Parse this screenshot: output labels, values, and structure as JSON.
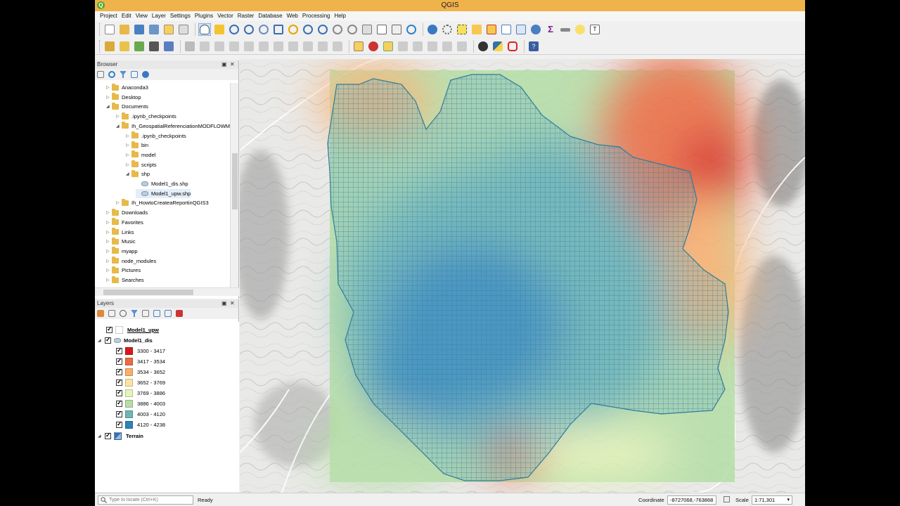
{
  "window": {
    "title": "QGIS",
    "logo_letter": "Q"
  },
  "menubar": [
    "Project",
    "Edit",
    "View",
    "Layer",
    "Settings",
    "Plugins",
    "Vector",
    "Raster",
    "Database",
    "Web",
    "Processing",
    "Help"
  ],
  "browser": {
    "title": "Browser",
    "items": [
      {
        "label": "Anaconda3",
        "type": "folder",
        "depth": 1,
        "state": "collapsed"
      },
      {
        "label": "Desktop",
        "type": "folder",
        "depth": 1,
        "state": "collapsed"
      },
      {
        "label": "Documents",
        "type": "folder",
        "depth": 1,
        "state": "expanded"
      },
      {
        "label": ".ipynb_checkpoints",
        "type": "folder",
        "depth": 2,
        "state": "collapsed"
      },
      {
        "label": "Ih_GeospatialReferenciationMODFLOWM",
        "type": "folder",
        "depth": 2,
        "state": "expanded"
      },
      {
        "label": ".ipynb_checkpoints",
        "type": "folder",
        "depth": 3,
        "state": "collapsed"
      },
      {
        "label": "bin",
        "type": "folder",
        "depth": 3,
        "state": "collapsed"
      },
      {
        "label": "model",
        "type": "folder",
        "depth": 3,
        "state": "collapsed"
      },
      {
        "label": "scripts",
        "type": "folder",
        "depth": 3,
        "state": "collapsed"
      },
      {
        "label": "shp",
        "type": "folder",
        "depth": 3,
        "state": "expanded"
      },
      {
        "label": "Model1_dis.shp",
        "type": "shp",
        "depth": 4,
        "state": "none"
      },
      {
        "label": "Model1_upw.shp",
        "type": "shp",
        "depth": 4,
        "state": "selected"
      },
      {
        "label": "Ih_HowtoCreateaReportinQGIS3",
        "type": "folder",
        "depth": 2,
        "state": "collapsed"
      },
      {
        "label": "Downloads",
        "type": "folder",
        "depth": 1,
        "state": "collapsed"
      },
      {
        "label": "Favorites",
        "type": "folder",
        "depth": 1,
        "state": "collapsed"
      },
      {
        "label": "Links",
        "type": "folder",
        "depth": 1,
        "state": "collapsed"
      },
      {
        "label": "Music",
        "type": "folder",
        "depth": 1,
        "state": "collapsed"
      },
      {
        "label": "myapp",
        "type": "folder",
        "depth": 1,
        "state": "collapsed"
      },
      {
        "label": "node_modules",
        "type": "folder",
        "depth": 1,
        "state": "collapsed"
      },
      {
        "label": "Pictures",
        "type": "folder",
        "depth": 1,
        "state": "collapsed"
      },
      {
        "label": "Searches",
        "type": "folder",
        "depth": 1,
        "state": "collapsed"
      }
    ]
  },
  "layers": {
    "title": "Layers",
    "items": [
      {
        "label": "Model1_upw",
        "kind": "layer",
        "checked": true,
        "bold": true,
        "underline": true
      },
      {
        "label": "Model1_dis",
        "kind": "layer-group",
        "checked": true,
        "bold": true
      },
      {
        "label": "3300 - 3417",
        "kind": "class",
        "checked": true,
        "color": "#d7191c"
      },
      {
        "label": "3417 - 3534",
        "kind": "class",
        "checked": true,
        "color": "#eb6a41"
      },
      {
        "label": "3534 - 3652",
        "kind": "class",
        "checked": true,
        "color": "#f9ae6a"
      },
      {
        "label": "3652 - 3769",
        "kind": "class",
        "checked": true,
        "color": "#fde3a2"
      },
      {
        "label": "3769 - 3886",
        "kind": "class",
        "checked": true,
        "color": "#e6f4b8"
      },
      {
        "label": "3886 - 4003",
        "kind": "class",
        "checked": true,
        "color": "#b5dea6"
      },
      {
        "label": "4003 - 4120",
        "kind": "class",
        "checked": true,
        "color": "#6db7b1"
      },
      {
        "label": "4120 - 4238",
        "kind": "class",
        "checked": true,
        "color": "#2b83ba"
      },
      {
        "label": "Terrain",
        "kind": "raster",
        "checked": true,
        "bold": true
      }
    ]
  },
  "statusbar": {
    "locator_placeholder": "Type to locate (Ctrl+K)",
    "message": "Ready",
    "coordinate_label": "Coordinate",
    "coordinate_value": "-8727068,-763868",
    "scale_label": "Scale",
    "scale_value": "1:71,301"
  },
  "colors": {
    "titlebar": "#f0b24a",
    "grid_line": "#2e7d9a",
    "elev_high": "#d7191c",
    "elev_low": "#2b83ba"
  }
}
